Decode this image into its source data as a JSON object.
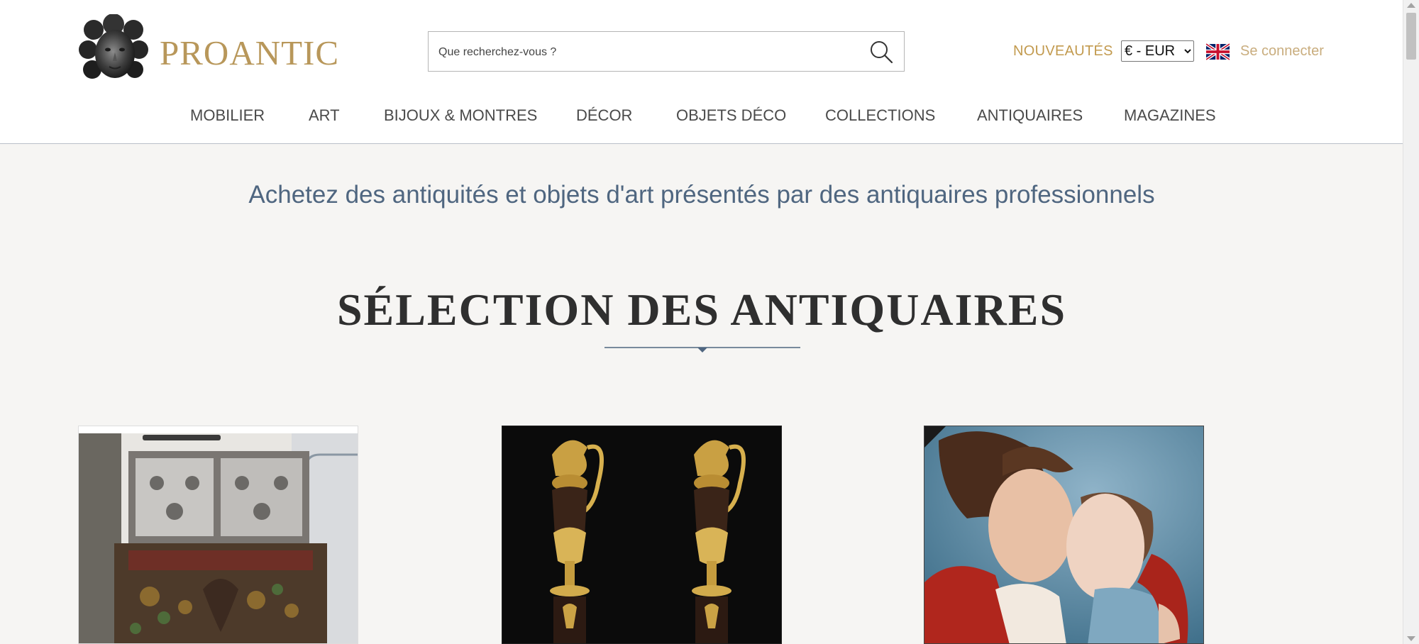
{
  "header": {
    "logo_text": "PROANTIC",
    "search": {
      "placeholder": "Que recherchez-vous ?",
      "value": ""
    },
    "new_label": "NOUVEAUTÉS",
    "currency": {
      "selected": "€ - EUR",
      "options": [
        "€ - EUR"
      ]
    },
    "language_icon": "uk-flag-icon",
    "login_label": "Se connecter"
  },
  "nav": {
    "items": [
      {
        "label": "MOBILIER"
      },
      {
        "label": "ART"
      },
      {
        "label": "BIJOUX & MONTRES"
      },
      {
        "label": "DÉCOR"
      },
      {
        "label": "OBJETS DÉCO"
      },
      {
        "label": "COLLECTIONS"
      },
      {
        "label": "ANTIQUAIRES"
      },
      {
        "label": "MAGAZINES"
      }
    ]
  },
  "main": {
    "tagline": "Achetez des antiquités et objets d'art présentés par des antiquaires professionnels",
    "section_title": "SÉLECTION DES ANTIQUAIRES"
  },
  "colors": {
    "brand_gold": "#b8975a",
    "tagline_blue": "#4f6680",
    "page_bg": "#f6f5f3"
  }
}
